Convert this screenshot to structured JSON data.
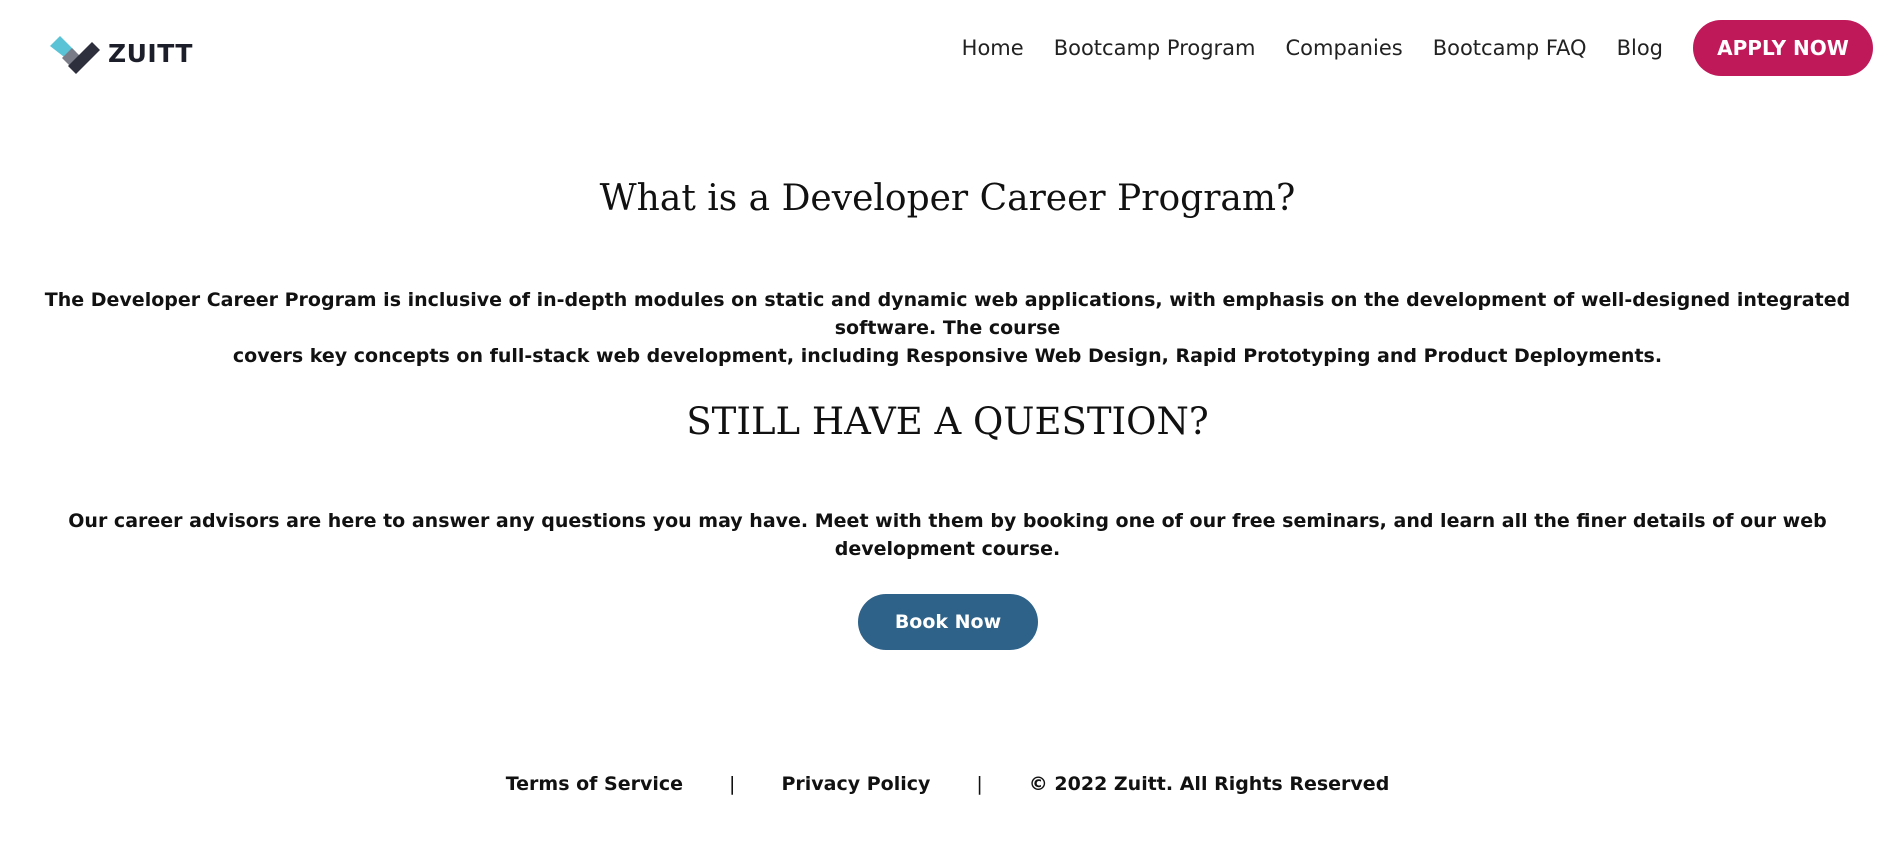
{
  "header": {
    "logo_text": "ZUITT",
    "nav": [
      {
        "label": "Home"
      },
      {
        "label": "Bootcamp Program"
      },
      {
        "label": "Companies"
      },
      {
        "label": "Bootcamp FAQ"
      },
      {
        "label": "Blog"
      }
    ],
    "apply_label": "APPLY NOW"
  },
  "main": {
    "heading_1": "What is a Developer Career Program?",
    "paragraph_1_line_1": "The Developer Career Program is inclusive of in-depth modules on static and dynamic web applications, with emphasis on the development of well-designed integrated software. The course",
    "paragraph_1_line_2": "covers key concepts on full-stack web development, including Responsive Web Design, Rapid Prototyping and Product Deployments.",
    "heading_2": "STILL HAVE A QUESTION?",
    "paragraph_2": "Our career advisors are here to answer any questions you may have. Meet with them by booking one of our free seminars, and learn all the finer details of our web development course.",
    "book_label": "Book Now"
  },
  "footer": {
    "terms": "Terms of Service",
    "separator": "|",
    "privacy": "Privacy Policy",
    "copyright": "© 2022 Zuitt. All Rights Reserved"
  },
  "colors": {
    "apply_button": "#c0195a",
    "book_button": "#2e6289",
    "logo_light": "#5bc3d6",
    "logo_dark": "#2d2f3d"
  },
  "icons": {
    "logo": "zuitt-check-icon"
  }
}
